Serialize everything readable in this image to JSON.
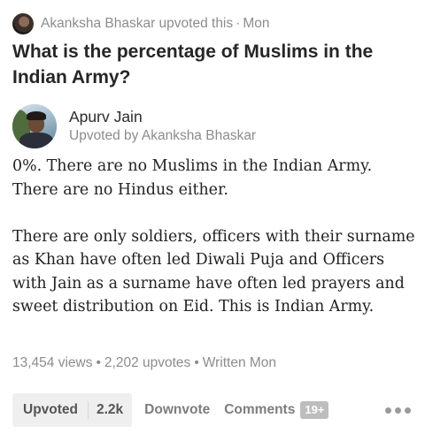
{
  "activity": {
    "text": "Akanksha Bhaskar upvoted this",
    "separator": "·",
    "time": "Mon"
  },
  "question": {
    "title": "What is the percentage of Muslims in the Indian Army?"
  },
  "author": {
    "name": "Apurv Jain",
    "subtitle": "Upvoted by Akanksha Bhaskar"
  },
  "answer": {
    "paragraphs": [
      "0%. There are no Muslims in the Indian Army. There are no Hindus either.",
      "There are only soldiers, officers with their surname as Khan have often led Diwali Puja and Officers with Jain as a surname have often led prayers and sweet distribution on Eid. This is Indian Army."
    ]
  },
  "stats": {
    "views": "13,454 views",
    "upvotes": "2,202 upvotes",
    "written": "Written Mon",
    "separator": "•"
  },
  "actions": {
    "upvote_label": "Upvoted",
    "upvote_count": "2.2k",
    "downvote_label": "Downvote",
    "comments_label": "Comments",
    "comments_count": "19+"
  },
  "icons": {
    "more": "more-dots-icon"
  }
}
